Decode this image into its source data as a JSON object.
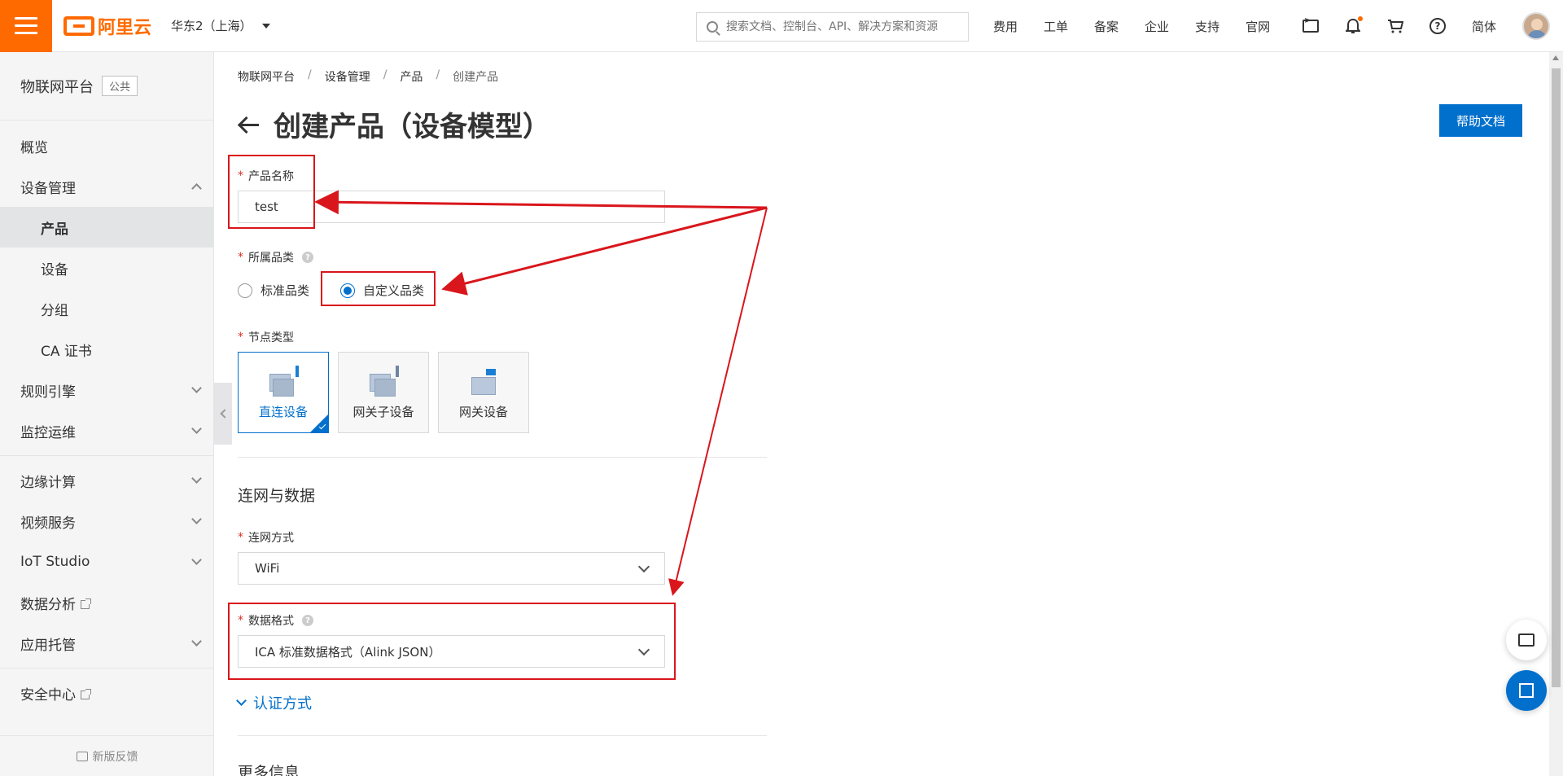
{
  "topbar": {
    "brand": "阿里云",
    "region": "华东2（上海）",
    "search_placeholder": "搜索文档、控制台、API、解决方案和资源",
    "nav": [
      "费用",
      "工单",
      "备案",
      "企业",
      "支持",
      "官网"
    ],
    "lang": "简体",
    "accent": "#ff6a00"
  },
  "sidebar": {
    "title": "物联网平台",
    "tag": "公共",
    "items": [
      {
        "label": "概览"
      },
      {
        "label": "设备管理"
      },
      {
        "label": "产品"
      },
      {
        "label": "设备"
      },
      {
        "label": "分组"
      },
      {
        "label": "CA 证书"
      },
      {
        "label": "规则引擎"
      },
      {
        "label": "监控运维"
      },
      {
        "label": "边缘计算"
      },
      {
        "label": "视频服务"
      },
      {
        "label": "IoT Studio"
      },
      {
        "label": "数据分析"
      },
      {
        "label": "应用托管"
      },
      {
        "label": "安全中心"
      }
    ],
    "footer": "新版反馈"
  },
  "breadcrumb": [
    "物联网平台",
    "设备管理",
    "产品",
    "创建产品"
  ],
  "page": {
    "title": "创建产品（设备模型）",
    "help_button": "帮助文档",
    "primary_color": "#0070cc"
  },
  "form": {
    "product_name_label": "产品名称",
    "product_name_value": "test",
    "category_label": "所属品类",
    "category_options": [
      "标准品类",
      "自定义品类"
    ],
    "category_selected": "自定义品类",
    "node_type_label": "节点类型",
    "node_types": [
      "直连设备",
      "网关子设备",
      "网关设备"
    ],
    "node_type_selected": "直连设备",
    "section_network": "连网与数据",
    "network_label": "连网方式",
    "network_value": "WiFi",
    "data_format_label": "数据格式",
    "data_format_value": "ICA 标准数据格式（Alink JSON）",
    "auth_link": "认证方式",
    "section_more": "更多信息"
  },
  "annotation_color": "#d9161c"
}
